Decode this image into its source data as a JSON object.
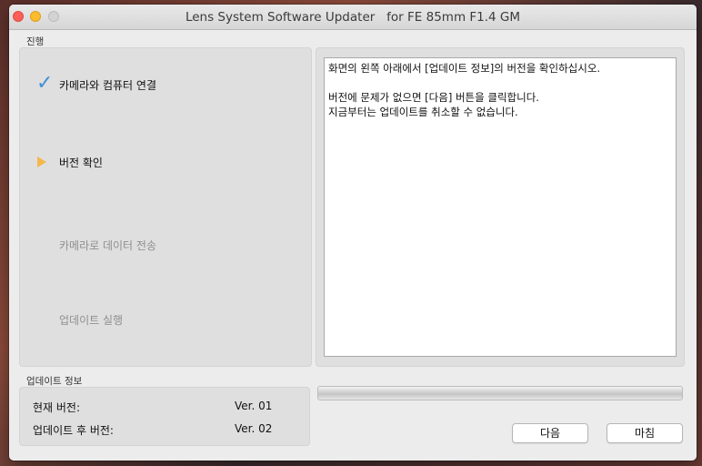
{
  "window": {
    "title": "Lens System Software Updater   for FE 85mm F1.4 GM"
  },
  "progress_section": {
    "label": "진행",
    "steps": [
      {
        "label": "카메라와 컴퓨터 연결",
        "status": "done",
        "icon": "checkmark-icon"
      },
      {
        "label": "버전 확인",
        "status": "current",
        "icon": "play-arrow-icon"
      },
      {
        "label": "카메라로 데이터 전송",
        "status": "pending"
      },
      {
        "label": "업데이트 실행",
        "status": "pending"
      }
    ]
  },
  "message": {
    "line1": "화면의 왼쪽 아래에서 [업데이트 정보]의 버전을 확인하십시오.",
    "line2": "버전에 문제가 없으면 [다음] 버튼을 클릭합니다.",
    "line3": "지금부터는 업데이트를 취소할 수 없습니다."
  },
  "update_info": {
    "label": "업데이트 정보",
    "current_label": "현재 버전:",
    "current_value": "Ver. 01",
    "after_label": "업데이트 후 버전:",
    "after_value": "Ver. 02"
  },
  "progress_bar": {
    "fraction": 0.0
  },
  "buttons": {
    "next": "다음",
    "finish": "마침"
  },
  "colors": {
    "check": "#3f8fd6",
    "arrow": "#f4b74a",
    "close_light": "#fc5f57",
    "minimize_light": "#fdbc2e",
    "maximize_light": "#d3d3d3"
  }
}
